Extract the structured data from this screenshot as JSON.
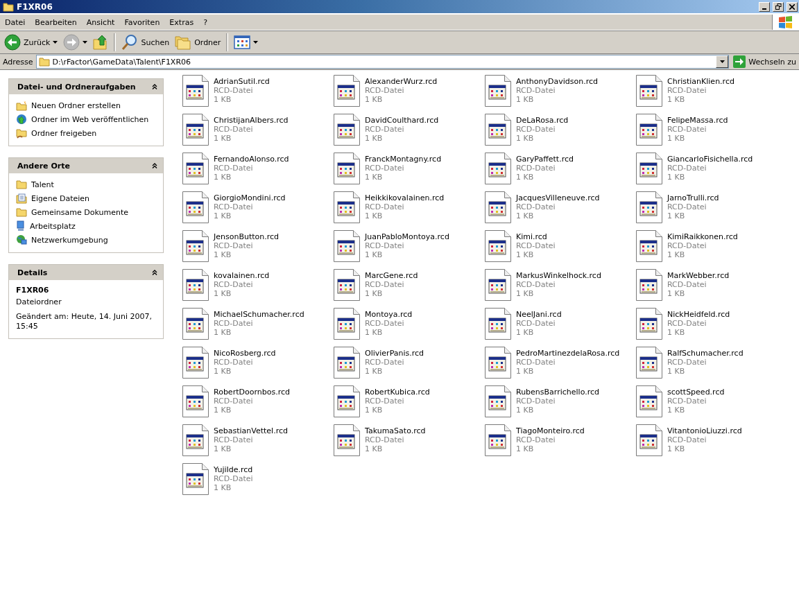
{
  "window": {
    "title": "F1XR06"
  },
  "menu": [
    "Datei",
    "Bearbeiten",
    "Ansicht",
    "Favoriten",
    "Extras",
    "?"
  ],
  "toolbar": [
    {
      "kind": "back",
      "label": "Zurück",
      "dropdown": true,
      "disabled": false
    },
    {
      "kind": "forward",
      "dropdown": true,
      "disabled": true
    },
    {
      "kind": "up",
      "dropdown": false,
      "disabled": false
    },
    {
      "kind": "separator"
    },
    {
      "kind": "search",
      "label": "Suchen",
      "dropdown": false,
      "disabled": false
    },
    {
      "kind": "folders",
      "label": "Ordner",
      "dropdown": false,
      "disabled": false
    },
    {
      "kind": "separator"
    },
    {
      "kind": "views",
      "dropdown": true,
      "disabled": false
    }
  ],
  "address": {
    "label": "Adresse",
    "value": "D:\\rFactor\\GameData\\Talent\\F1XR06",
    "go_label": "Wechseln zu"
  },
  "sidebar": [
    {
      "kind": "links",
      "title": "Datei- und Ordneraufgaben",
      "items": [
        {
          "kind": "new-folder",
          "label": "Neuen Ordner erstellen"
        },
        {
          "kind": "publish",
          "label": "Ordner im Web veröffentlichen"
        },
        {
          "kind": "share",
          "label": "Ordner freigeben"
        }
      ]
    },
    {
      "kind": "links",
      "title": "Andere Orte",
      "items": [
        {
          "kind": "folder",
          "label": "Talent"
        },
        {
          "kind": "documents",
          "label": "Eigene Dateien"
        },
        {
          "kind": "folder",
          "label": "Gemeinsame Dokumente"
        },
        {
          "kind": "computer",
          "label": "Arbeitsplatz"
        },
        {
          "kind": "network",
          "label": "Netzwerkumgebung"
        }
      ]
    },
    {
      "kind": "details",
      "title": "Details",
      "name": "F1XR06",
      "type": "Dateiordner",
      "modified": "Geändert am: Heute, 14. Juni 2007, 15:45"
    }
  ],
  "files": [
    {
      "name": "AdrianSutil.rcd",
      "type": "RCD-Datei",
      "size": "1 KB"
    },
    {
      "name": "AlexanderWurz.rcd",
      "type": "RCD-Datei",
      "size": "1 KB"
    },
    {
      "name": "AnthonyDavidson.rcd",
      "type": "RCD-Datei",
      "size": "1 KB"
    },
    {
      "name": "ChristianKlien.rcd",
      "type": "RCD-Datei",
      "size": "1 KB"
    },
    {
      "name": "ChristijanAlbers.rcd",
      "type": "RCD-Datei",
      "size": "1 KB"
    },
    {
      "name": "DavidCoulthard.rcd",
      "type": "RCD-Datei",
      "size": "1 KB"
    },
    {
      "name": "DeLaRosa.rcd",
      "type": "RCD-Datei",
      "size": "1 KB"
    },
    {
      "name": "FelipeMassa.rcd",
      "type": "RCD-Datei",
      "size": "1 KB"
    },
    {
      "name": "FernandoAlonso.rcd",
      "type": "RCD-Datei",
      "size": "1 KB"
    },
    {
      "name": "FranckMontagny.rcd",
      "type": "RCD-Datei",
      "size": "1 KB"
    },
    {
      "name": "GaryPaffett.rcd",
      "type": "RCD-Datei",
      "size": "1 KB"
    },
    {
      "name": "GiancarloFisichella.rcd",
      "type": "RCD-Datei",
      "size": "1 KB"
    },
    {
      "name": "GiorgioMondini.rcd",
      "type": "RCD-Datei",
      "size": "1 KB"
    },
    {
      "name": "Heikkikovalainen.rcd",
      "type": "RCD-Datei",
      "size": "1 KB"
    },
    {
      "name": "JacquesVilleneuve.rcd",
      "type": "RCD-Datei",
      "size": "1 KB"
    },
    {
      "name": "JarnoTrulli.rcd",
      "type": "RCD-Datei",
      "size": "1 KB"
    },
    {
      "name": "JensonButton.rcd",
      "type": "RCD-Datei",
      "size": "1 KB"
    },
    {
      "name": "JuanPabloMontoya.rcd",
      "type": "RCD-Datei",
      "size": "1 KB"
    },
    {
      "name": "Kimi.rcd",
      "type": "RCD-Datei",
      "size": "1 KB"
    },
    {
      "name": "KimiRaikkonen.rcd",
      "type": "RCD-Datei",
      "size": "1 KB"
    },
    {
      "name": "kovalainen.rcd",
      "type": "RCD-Datei",
      "size": "1 KB"
    },
    {
      "name": "MarcGene.rcd",
      "type": "RCD-Datei",
      "size": "1 KB"
    },
    {
      "name": "MarkusWinkelhock.rcd",
      "type": "RCD-Datei",
      "size": "1 KB"
    },
    {
      "name": "MarkWebber.rcd",
      "type": "RCD-Datei",
      "size": "1 KB"
    },
    {
      "name": "MichaelSchumacher.rcd",
      "type": "RCD-Datei",
      "size": "1 KB"
    },
    {
      "name": "Montoya.rcd",
      "type": "RCD-Datei",
      "size": "1 KB"
    },
    {
      "name": "NeelJani.rcd",
      "type": "RCD-Datei",
      "size": "1 KB"
    },
    {
      "name": "NickHeidfeld.rcd",
      "type": "RCD-Datei",
      "size": "1 KB"
    },
    {
      "name": "NicoRosberg.rcd",
      "type": "RCD-Datei",
      "size": "1 KB"
    },
    {
      "name": "OlivierPanis.rcd",
      "type": "RCD-Datei",
      "size": "1 KB"
    },
    {
      "name": "PedroMartinezdelaRosa.rcd",
      "type": "RCD-Datei",
      "size": "1 KB"
    },
    {
      "name": "RalfSchumacher.rcd",
      "type": "RCD-Datei",
      "size": "1 KB"
    },
    {
      "name": "RobertDoornbos.rcd",
      "type": "RCD-Datei",
      "size": "1 KB"
    },
    {
      "name": "RobertKubica.rcd",
      "type": "RCD-Datei",
      "size": "1 KB"
    },
    {
      "name": "RubensBarrichello.rcd",
      "type": "RCD-Datei",
      "size": "1 KB"
    },
    {
      "name": "scottSpeed.rcd",
      "type": "RCD-Datei",
      "size": "1 KB"
    },
    {
      "name": "SebastianVettel.rcd",
      "type": "RCD-Datei",
      "size": "1 KB"
    },
    {
      "name": "TakumaSato.rcd",
      "type": "RCD-Datei",
      "size": "1 KB"
    },
    {
      "name": "TiagoMonteiro.rcd",
      "type": "RCD-Datei",
      "size": "1 KB"
    },
    {
      "name": "VitantonioLiuzzi.rcd",
      "type": "RCD-Datei",
      "size": "1 KB"
    },
    {
      "name": "YujiIde.rcd",
      "type": "RCD-Datei",
      "size": "1 KB"
    }
  ]
}
